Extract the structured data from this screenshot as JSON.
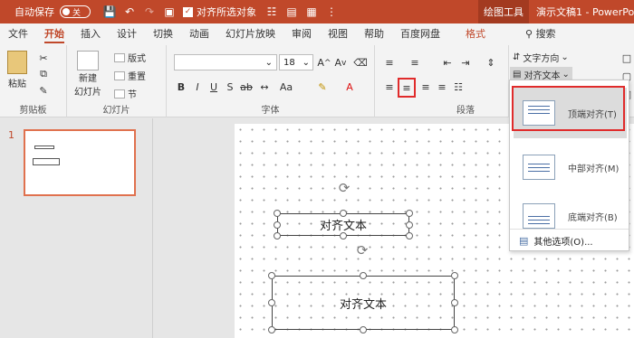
{
  "titlebar": {
    "autosave_label": "自动保存",
    "autosave_state": "关",
    "align_selected_label": "对齐所选对象",
    "context_tool": "绘图工具",
    "doc_title": "演示文稿1 - PowerPoi"
  },
  "tabs": [
    "文件",
    "开始",
    "插入",
    "设计",
    "切换",
    "动画",
    "幻灯片放映",
    "审阅",
    "视图",
    "帮助",
    "百度网盘",
    "格式",
    "搜索"
  ],
  "ribbon": {
    "clipboard": {
      "paste": "粘贴",
      "group": "剪贴板"
    },
    "slides": {
      "new_slide": "新建",
      "new_slide2": "幻灯片",
      "layout": "版式",
      "reset": "重置",
      "section": "节",
      "group": "幻灯片"
    },
    "font": {
      "font_name": "",
      "font_size": "18",
      "group": "字体"
    },
    "paragraph": {
      "text_direction": "文字方向",
      "align_text": "对齐文本",
      "group": "段落"
    }
  },
  "slide_panel": {
    "number": "1"
  },
  "canvas": {
    "textbox1": "对齐文本",
    "textbox2": "对齐文本"
  },
  "dropdown": {
    "items": [
      {
        "label": "顶端对齐(T)"
      },
      {
        "label": "中部对齐(M)"
      },
      {
        "label": "底端对齐(B)"
      }
    ],
    "more": "其他选项(O)..."
  }
}
